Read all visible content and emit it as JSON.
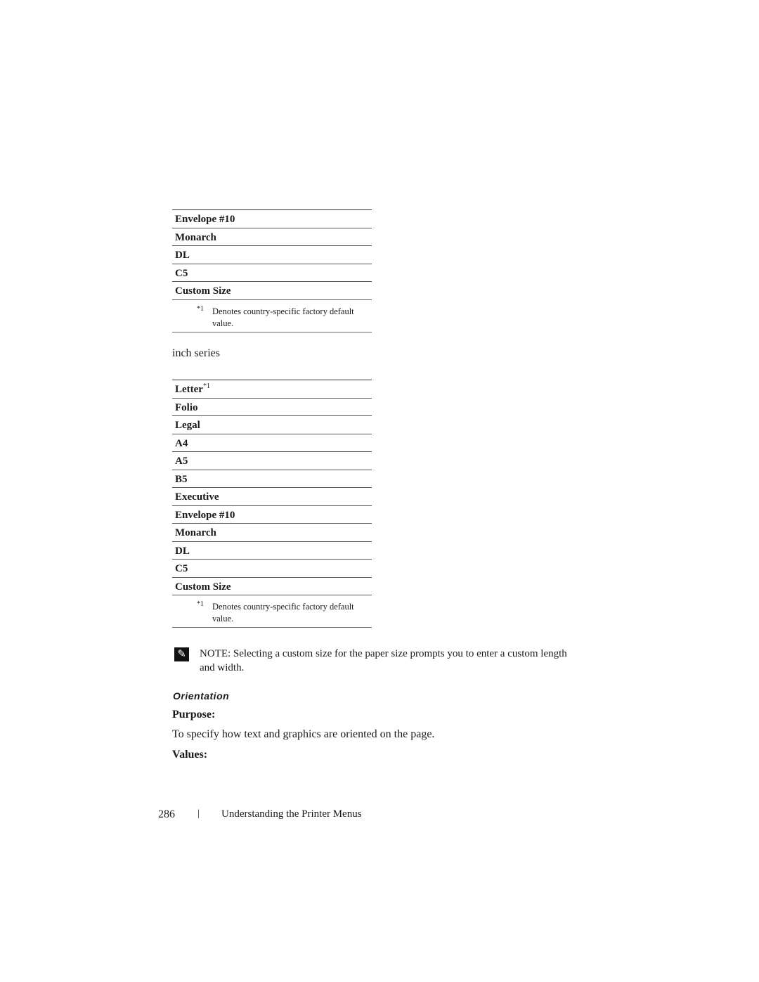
{
  "metric_table": {
    "rows": [
      "Envelope #10",
      "Monarch",
      "DL",
      "C5",
      "Custom Size"
    ],
    "footnote_mark": "*1",
    "footnote_text": "Denotes country-specific factory default value."
  },
  "inch_series_label": "inch series",
  "inch_table": {
    "rows": [
      {
        "label": "Letter",
        "sup": "*1"
      },
      {
        "label": "Folio"
      },
      {
        "label": "Legal"
      },
      {
        "label": "A4"
      },
      {
        "label": "A5"
      },
      {
        "label": "B5"
      },
      {
        "label": "Executive"
      },
      {
        "label": "Envelope #10"
      },
      {
        "label": "Monarch"
      },
      {
        "label": "DL"
      },
      {
        "label": "C5"
      },
      {
        "label": "Custom Size"
      }
    ],
    "footnote_mark": "*1",
    "footnote_text": "Denotes country-specific factory default value."
  },
  "note": {
    "icon": "pencil-note-icon",
    "text": "NOTE: Selecting a custom size for the paper size prompts you to enter a custom length and width."
  },
  "section": {
    "title": "Orientation",
    "purpose_label": "Purpose:",
    "purpose_text": "To specify how text and graphics are oriented on the page.",
    "values_label": "Values:"
  },
  "footer": {
    "page_number": "286",
    "separator": "|",
    "chapter_title": "Understanding the Printer Menus"
  }
}
